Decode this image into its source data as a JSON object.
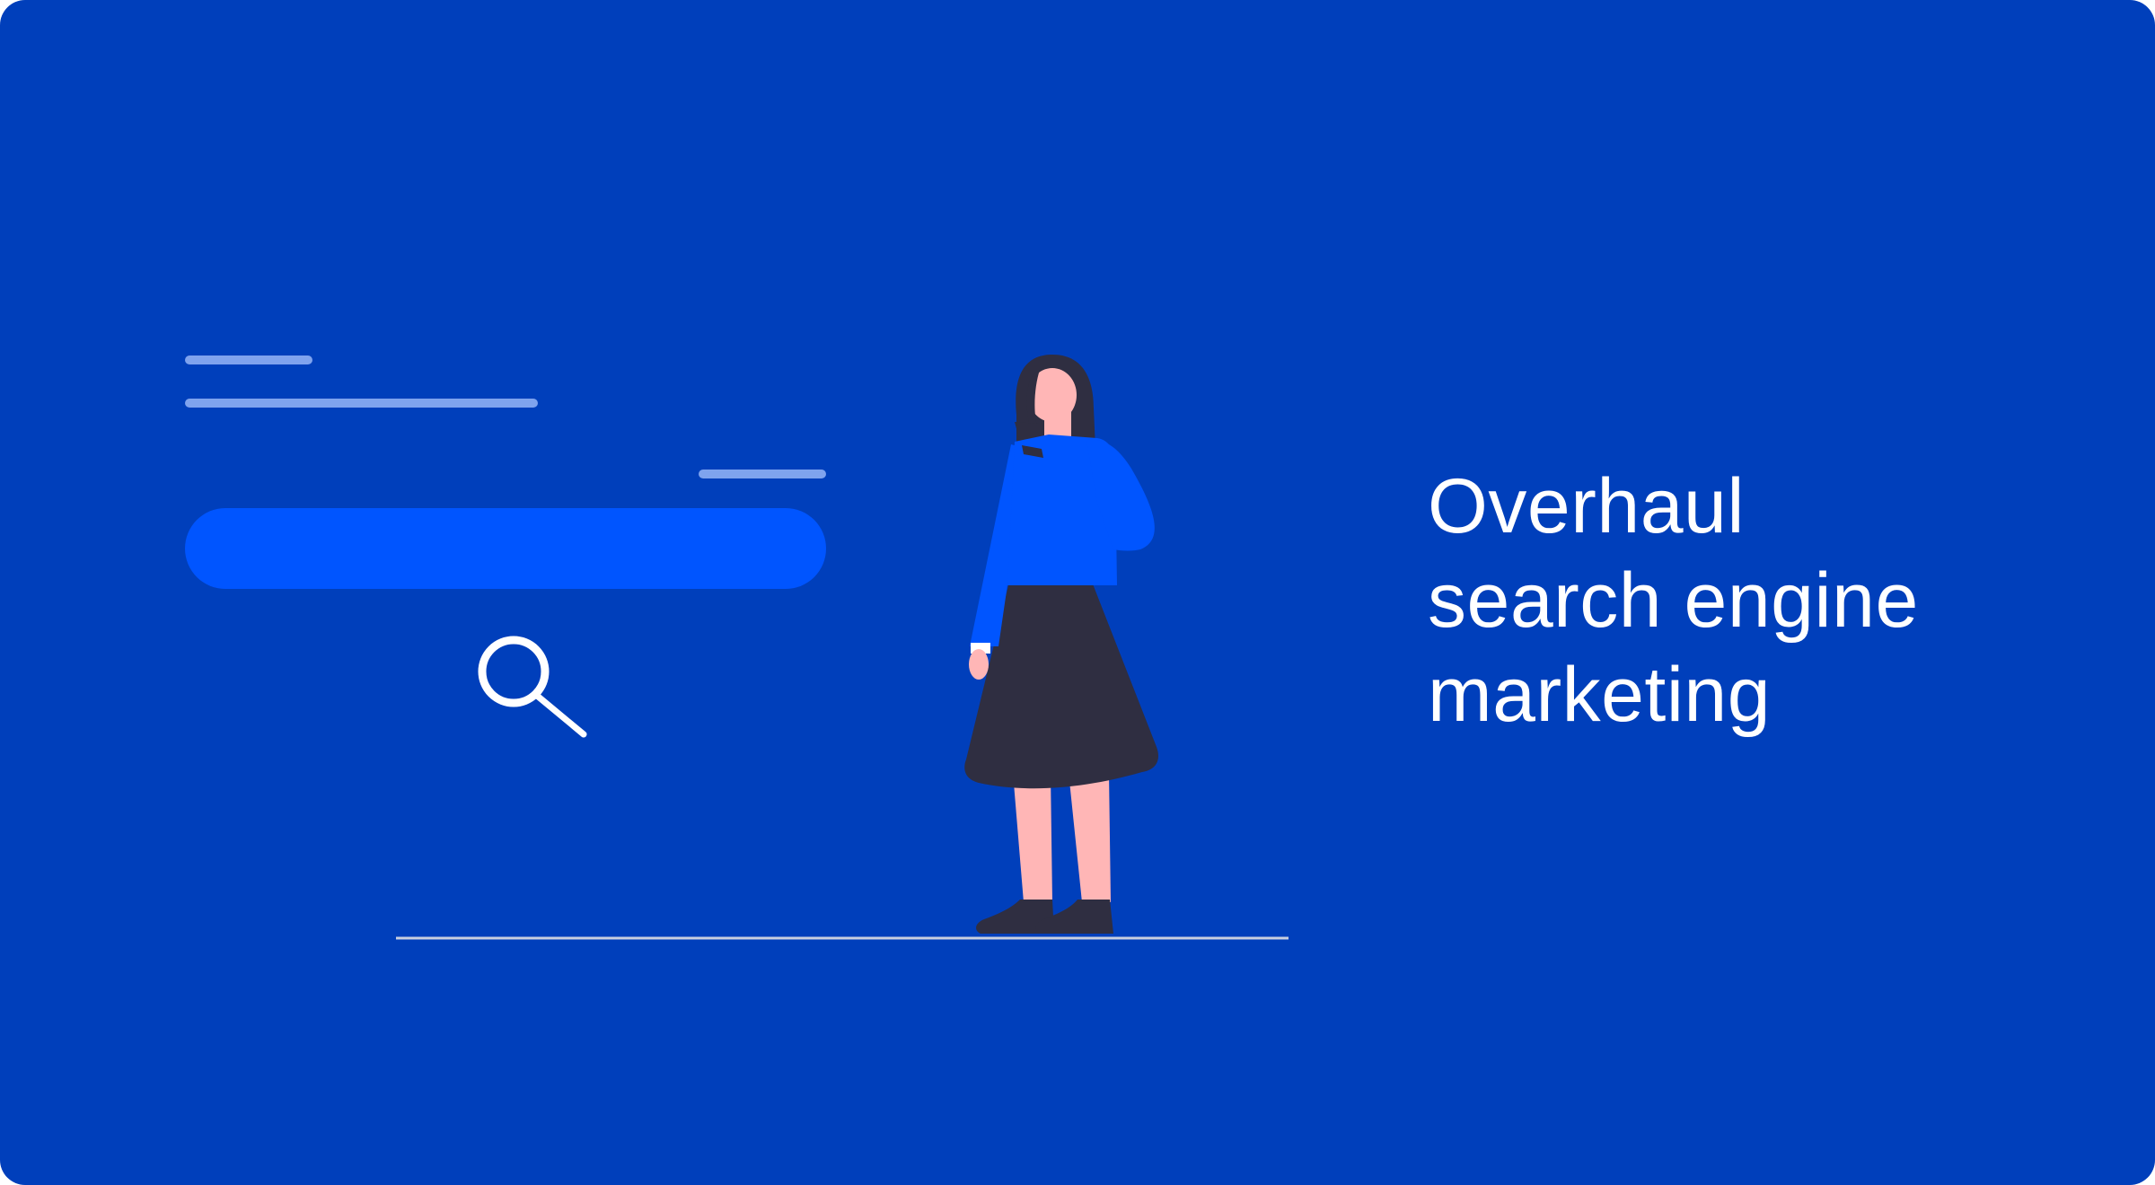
{
  "headline": {
    "lines": [
      "Overhaul",
      "search engine",
      "marketing"
    ]
  },
  "icons": {
    "search": "magnifying-glass-icon"
  },
  "colors": {
    "background": "#003fbb",
    "search_bar": "#0055ff",
    "placeholder_lines": "#7fa3ee",
    "headline_text": "#ffffff",
    "shirt": "#0055ff",
    "skirt_hair_shoes": "#2f2e41",
    "skin": "#ffb6b6",
    "ground": "#c9cfe0"
  }
}
